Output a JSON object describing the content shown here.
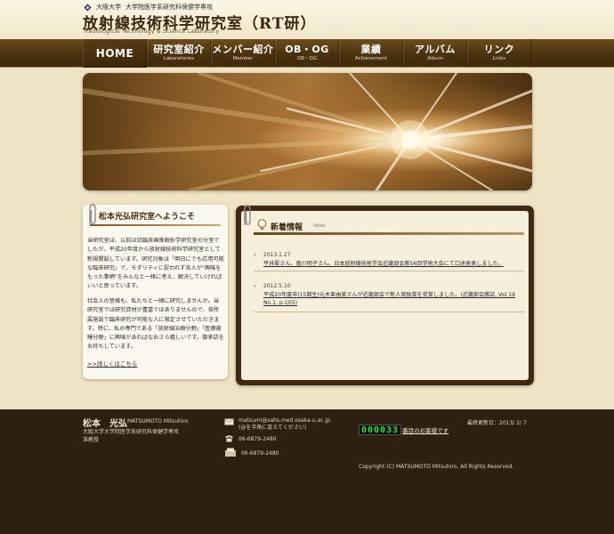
{
  "header": {
    "university": "大阪大学",
    "department": "大学院医学系研究科保健学専攻",
    "title": "放射線技術科学研究室（RT研）",
    "subtitle": "Radiological Technology & Science Laboratory"
  },
  "nav": {
    "items": [
      {
        "label": "HOME",
        "sub": ""
      },
      {
        "label": "研究室紹介",
        "sub": "Laboratories"
      },
      {
        "label": "メンバー紹介",
        "sub": "Member"
      },
      {
        "label": "OB・OG",
        "sub": "OB・OG"
      },
      {
        "label": "業績",
        "sub": "Achievement"
      },
      {
        "label": "アルバム",
        "sub": "Album"
      },
      {
        "label": "リンク",
        "sub": "Links"
      }
    ]
  },
  "welcome": {
    "heading": "松本光弘研究室へようこそ",
    "para1": "当研究室は、以前は旧臨床画像解析学研究室の分室でしたが、平成20年度から放射線技術科学研究室として新規開設しています。研究対象は「明日にでも応用可能な臨床研究」で、モダリティに捉われず各人が\"興味をもった事柄\"をみんなと一緒に考え、解決していければいいと思っています。",
    "para2": "社会人の皆様も、私たちと一緒に研究しませんか。当研究室では研究資材が豊富ではありませんので、各所属施設で臨床研究が可能な人に限定させていただきます。特に、私の専門である「放射線治療分野」「医療被曝分野」に興味があればなおさら嬉しいです。御来訪をお待ちしています。",
    "more_link": ">>詳しくはこちら"
  },
  "news": {
    "heading": "新着情報",
    "heading_en": "News",
    "items": [
      {
        "date": "2013.1.27",
        "text": "平井翠さん、香川明子さん、日本放射線技術学会近畿部会第56回学術大会にて口述発表しました。"
      },
      {
        "date": "2012.5.10",
        "text": "平成20年度卒(15期生)元木亜由美さんが近畿部会で新人奨励賞を受賞しました。(近畿部会雑誌, Vol.19 No.1, p-105)"
      }
    ]
  },
  "footer": {
    "name": "松本　光弘",
    "name_en": "MATSUMOTO Mitsuhiro",
    "affiliation": "大阪大学大学院医学系研究科保健学専攻",
    "position": "准教授",
    "email": "matsumi@sahs.med.osaka-u.ac.jp",
    "email_note": "(@を半角に変えてください)",
    "tel": "06-6879-2480",
    "fax": "06-6879-2480",
    "counter_digits": "000033",
    "counter_suffix": "番目のお客様です",
    "last_updated": "最終更新日：2013/ 2/ 7",
    "copyright": "Copyright (C) MATSUMOTO Mitsuhiro, All Rights Reserved."
  }
}
